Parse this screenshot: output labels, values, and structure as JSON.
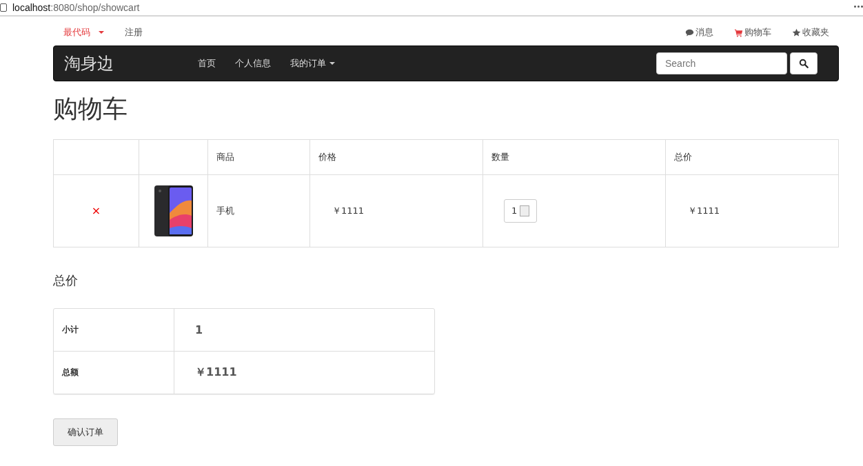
{
  "address_bar": {
    "host": "localhost",
    "path": ":8080/shop/showcart"
  },
  "top_links_left": [
    {
      "label": "最代码",
      "kind": "dropdown",
      "color": "#e4393c"
    },
    {
      "label": "注册",
      "kind": "link",
      "color": "#555555"
    }
  ],
  "top_links_right": [
    {
      "label": "消息",
      "kind": "comment",
      "color": "#555555"
    },
    {
      "label": "购物车",
      "kind": "cart",
      "color": "#555555"
    },
    {
      "label": "收藏夹",
      "kind": "star",
      "color": "#555555"
    }
  ],
  "navbar": {
    "brand": "淘身边",
    "items": [
      {
        "label": "首页",
        "kind": "link"
      },
      {
        "label": "个人信息",
        "kind": "link"
      },
      {
        "label": "我的订单",
        "kind": "dropdown"
      }
    ],
    "search": {
      "placeholder": "Search"
    }
  },
  "page_title": "购物车",
  "cart_table": {
    "columns": [
      "商品",
      "价格",
      "数量",
      "总价"
    ],
    "rows": [
      {
        "remove": "×",
        "product": "手机",
        "price": "￥1111",
        "quantity": "1",
        "total": "￥1111"
      }
    ]
  },
  "summary": {
    "title": "总价",
    "rows": [
      {
        "label": "小计",
        "value": "1"
      },
      {
        "label": "总额",
        "value": "￥1111"
      }
    ]
  },
  "confirm_button": "确认订单"
}
